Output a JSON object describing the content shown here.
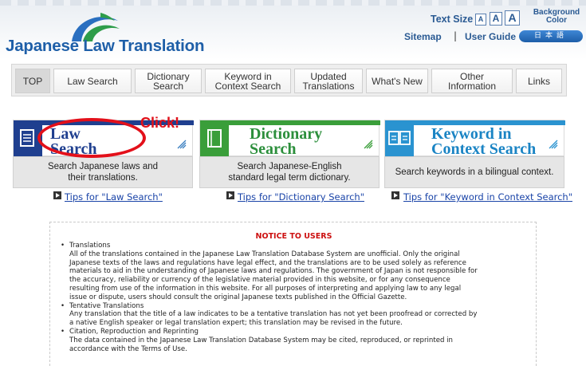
{
  "header": {
    "logo_text": "Japanese Law Translation",
    "text_size_label": "Text Size",
    "text_size_small": "A",
    "text_size_medium": "A",
    "text_size_large": "A",
    "background_color_line1": "Background",
    "background_color_line2": "Color",
    "sitemap": "Sitemap",
    "separator": "|",
    "user_guide": "User Guide",
    "japanese_button": "日本語"
  },
  "nav": {
    "tabs": [
      {
        "label": "TOP"
      },
      {
        "label": "Law Search"
      },
      {
        "label": "Dictionary Search"
      },
      {
        "label": "Keyword in Context Search"
      },
      {
        "label": "Updated Translations"
      },
      {
        "label": "What's New"
      },
      {
        "label": "Other Information"
      },
      {
        "label": "Links"
      }
    ]
  },
  "features": [
    {
      "title": "Law Search",
      "title_line1": "Law",
      "title_line2": "Search",
      "desc_line1": "Search Japanese laws and",
      "desc_line2": "their translations.",
      "tip": "Tips for \"Law Search\""
    },
    {
      "title": "Dictionary Search",
      "title_line1": "Dictionary",
      "title_line2": "Search",
      "desc_line1": "Search Japanese-English",
      "desc_line2": "standard legal term dictionary.",
      "tip": "Tips for \"Dictionary Search\""
    },
    {
      "title": "Keyword in Context Search",
      "title_line1": "Keyword in",
      "title_line2": "Context Search",
      "desc_line1": "Search keywords in a bilingual context.",
      "desc_line2": "",
      "tip": "Tips for \"Keyword in Context Search\""
    }
  ],
  "annotation": {
    "click_label": "Click!"
  },
  "notice": {
    "title": "NOTICE TO USERS",
    "items": [
      {
        "heading": "Translations",
        "lines": [
          "All of the translations contained in the Japanese Law Translation Database System are unofficial. Only the original",
          "Japanese texts of the laws and regulations have legal effect, and the translations are to be used solely as reference",
          "materials to aid in the understanding of Japanese laws and regulations. The government of Japan is not responsible for",
          "the accuracy, reliability or currency of the legislative material provided in this website, or for any consequence",
          "resulting from use of the information in this website. For all purposes of interpreting and applying law to any legal",
          "issue or dispute, users should consult the original Japanese texts published in the Official Gazette."
        ]
      },
      {
        "heading": "Tentative Translations",
        "lines": [
          "Any translation that the title of a law indicates to be a tentative translation has not yet been proofread or corrected by",
          "a native English speaker or legal translation expert; this translation may be revised in the future."
        ]
      },
      {
        "heading": "Citation, Reproduction and Reprinting",
        "lines": [
          "The data contained in the Japanese Law Translation Database System may be cited, reproduced, or reprinted in",
          "accordance with the Terms of Use."
        ]
      }
    ]
  },
  "colors": {
    "brand_blue": "#1e5fa8",
    "logo_green": "#2e9d4a",
    "law_search_blue": "#1f3f8f",
    "dictionary_green": "#2c8f3c",
    "keyword_teal": "#1a84c4",
    "annotation_red": "#e3101a",
    "notice_red": "#cc1010"
  }
}
